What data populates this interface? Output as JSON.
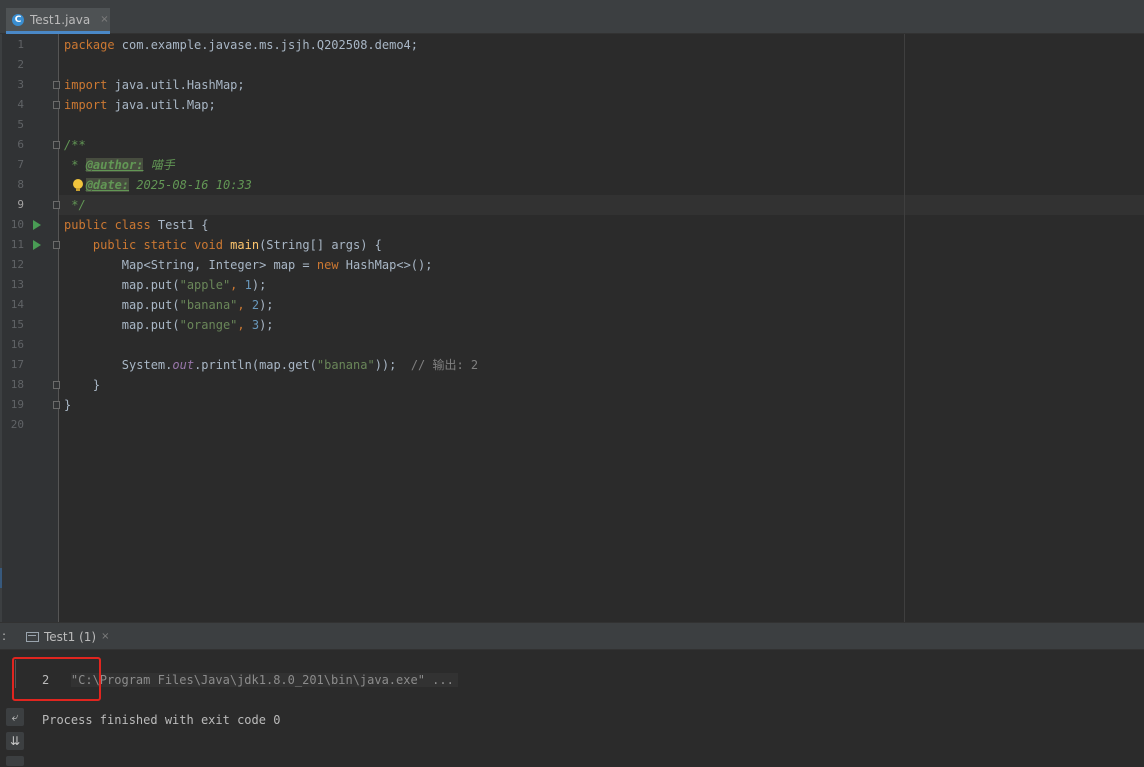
{
  "editor_tab": {
    "label": "Test1.java",
    "icon": "C",
    "close": "×"
  },
  "code_lines": [
    {
      "n": "1",
      "segments": [
        {
          "t": "package ",
          "c": "kw"
        },
        {
          "t": "com.example.javase.ms.jsjh.Q202508.demo4;",
          "c": ""
        }
      ]
    },
    {
      "n": "2",
      "segments": []
    },
    {
      "n": "3",
      "segments": [
        {
          "t": "import ",
          "c": "kw"
        },
        {
          "t": "java.util.HashMap;",
          "c": ""
        }
      ]
    },
    {
      "n": "4",
      "segments": [
        {
          "t": "import ",
          "c": "kw"
        },
        {
          "t": "java.util.Map;",
          "c": ""
        }
      ]
    },
    {
      "n": "5",
      "segments": []
    },
    {
      "n": "6",
      "segments": [
        {
          "t": "/**",
          "c": "doc"
        }
      ]
    },
    {
      "n": "7",
      "segments": [
        {
          "t": " * ",
          "c": "doc"
        },
        {
          "t": "@author:",
          "c": "tag"
        },
        {
          "t": " 喵手",
          "c": "doc"
        }
      ]
    },
    {
      "n": "8",
      "segments": [
        {
          "t": "   ",
          "c": ""
        },
        {
          "t": "@date:",
          "c": "tag"
        },
        {
          "t": " 2025-08-16 10:33",
          "c": "doc"
        }
      ]
    },
    {
      "n": "9",
      "segments": [
        {
          "t": " */",
          "c": "doc"
        }
      ]
    },
    {
      "n": "10",
      "segments": [
        {
          "t": "public class ",
          "c": "kw"
        },
        {
          "t": "Test1 {",
          "c": ""
        }
      ]
    },
    {
      "n": "11",
      "segments": [
        {
          "t": "    public static void ",
          "c": "kw"
        },
        {
          "t": "main",
          "c": "fn"
        },
        {
          "t": "(String[] args) {",
          "c": ""
        }
      ]
    },
    {
      "n": "12",
      "segments": [
        {
          "t": "        Map<String, Integer> map = ",
          "c": ""
        },
        {
          "t": "new ",
          "c": "kw"
        },
        {
          "t": "HashMap<>();",
          "c": ""
        }
      ]
    },
    {
      "n": "13",
      "segments": [
        {
          "t": "        map.put(",
          "c": ""
        },
        {
          "t": "\"apple\"",
          "c": "str"
        },
        {
          "t": ", ",
          "c": "kw"
        },
        {
          "t": "1",
          "c": "num"
        },
        {
          "t": ");",
          "c": ""
        }
      ]
    },
    {
      "n": "14",
      "segments": [
        {
          "t": "        map.put(",
          "c": ""
        },
        {
          "t": "\"banana\"",
          "c": "str"
        },
        {
          "t": ", ",
          "c": "kw"
        },
        {
          "t": "2",
          "c": "num"
        },
        {
          "t": ");",
          "c": ""
        }
      ]
    },
    {
      "n": "15",
      "segments": [
        {
          "t": "        map.put(",
          "c": ""
        },
        {
          "t": "\"orange\"",
          "c": "str"
        },
        {
          "t": ", ",
          "c": "kw"
        },
        {
          "t": "3",
          "c": "num"
        },
        {
          "t": ");",
          "c": ""
        }
      ]
    },
    {
      "n": "16",
      "segments": []
    },
    {
      "n": "17",
      "segments": [
        {
          "t": "        System.",
          "c": ""
        },
        {
          "t": "out",
          "c": "fld"
        },
        {
          "t": ".println(map.get(",
          "c": ""
        },
        {
          "t": "\"banana\"",
          "c": "str"
        },
        {
          "t": "));  ",
          "c": ""
        },
        {
          "t": "// 输出: 2",
          "c": "cmt"
        }
      ]
    },
    {
      "n": "18",
      "segments": [
        {
          "t": "    }",
          "c": ""
        }
      ]
    },
    {
      "n": "19",
      "segments": [
        {
          "t": "}",
          "c": ""
        }
      ]
    },
    {
      "n": "20",
      "segments": []
    }
  ],
  "current_line": "9",
  "run_panel": {
    "prefix": ":",
    "tab_label": "Test1 (1)",
    "close": "×",
    "console": [
      "\"C:\\Program Files\\Java\\jdk1.8.0_201\\bin\\java.exe\" ...",
      "2",
      "",
      "Process finished with exit code 0"
    ]
  },
  "icons": [
    "java-class-icon",
    "run-gutter-icon",
    "intention-bulb-icon",
    "soft-wrap-icon",
    "scroll-to-end-icon"
  ],
  "colors": {
    "background": "#2b2b2b",
    "keyword": "#cc7832",
    "string": "#6a8759",
    "number": "#6897bb",
    "highlight": "#e0251f"
  }
}
